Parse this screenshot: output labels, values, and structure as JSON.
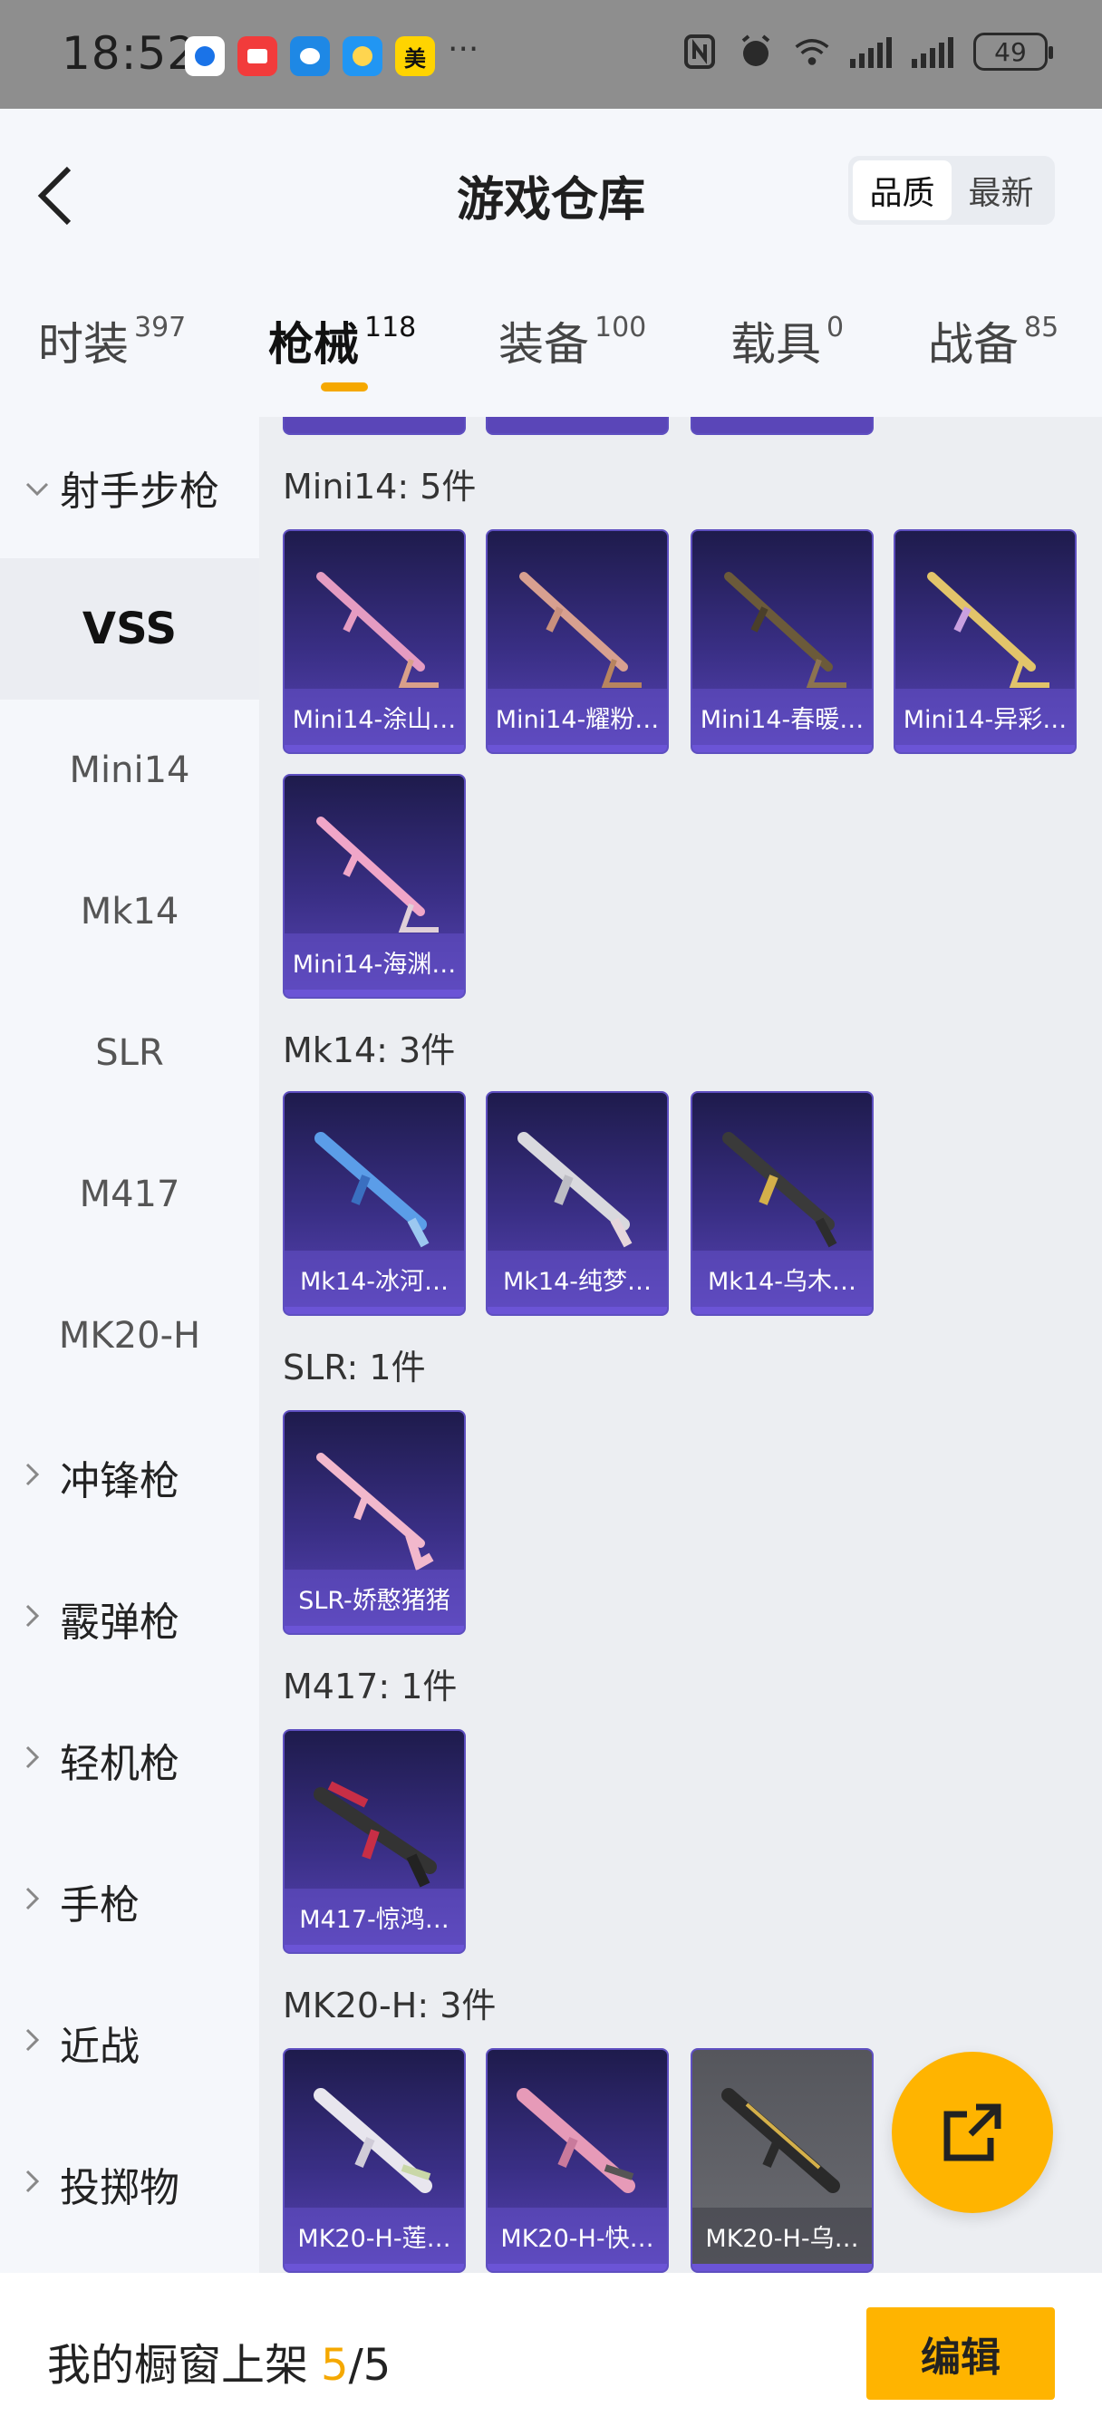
{
  "status_bar": {
    "time": "18:52",
    "notification_app_label": "美",
    "more": "···",
    "battery": "49"
  },
  "header": {
    "title": "游戏仓库",
    "sort_options": [
      {
        "label": "品质",
        "active": true
      },
      {
        "label": "最新",
        "active": false
      }
    ]
  },
  "tabs": [
    {
      "label": "时装",
      "count": "397",
      "active": false
    },
    {
      "label": "枪械",
      "count": "118",
      "active": true
    },
    {
      "label": "装备",
      "count": "100",
      "active": false
    },
    {
      "label": "载具",
      "count": "0",
      "active": false
    },
    {
      "label": "战备",
      "count": "85",
      "active": false
    }
  ],
  "sidebar": {
    "items": [
      {
        "label": "射手步枪",
        "type": "group",
        "expanded": true
      },
      {
        "label": "VSS",
        "type": "sub",
        "selected": true
      },
      {
        "label": "Mini14",
        "type": "sub"
      },
      {
        "label": "Mk14",
        "type": "sub"
      },
      {
        "label": "SLR",
        "type": "sub"
      },
      {
        "label": "M417",
        "type": "sub"
      },
      {
        "label": "MK20-H",
        "type": "sub"
      },
      {
        "label": "冲锋枪",
        "type": "group"
      },
      {
        "label": "霰弹枪",
        "type": "group"
      },
      {
        "label": "轻机枪",
        "type": "group"
      },
      {
        "label": "手枪",
        "type": "group"
      },
      {
        "label": "近战",
        "type": "group"
      },
      {
        "label": "投掷物",
        "type": "group"
      }
    ]
  },
  "sections": [
    {
      "title": "Mini14: 5件",
      "items": [
        "Mini14-涂山…",
        "Mini14-耀粉…",
        "Mini14-春暖…",
        "Mini14-异彩…",
        "Mini14-海渊…"
      ]
    },
    {
      "title": "Mk14: 3件",
      "items": [
        "Mk14-冰河…",
        "Mk14-纯梦…",
        "Mk14-乌木…"
      ]
    },
    {
      "title": "SLR: 1件",
      "items": [
        "SLR-娇憨猪猪"
      ]
    },
    {
      "title": "M417: 1件",
      "items": [
        "M417-惊鸿…"
      ]
    },
    {
      "title": "MK20-H: 3件",
      "items": [
        "MK20-H-莲…",
        "MK20-H-快…",
        "MK20-H-乌…"
      ]
    }
  ],
  "bottom_bar": {
    "label": "我的橱窗上架",
    "count": "5",
    "slash": "/",
    "total": "5",
    "edit_button": "编辑"
  },
  "colors": {
    "accent": "#ffb400",
    "card_purple": "#3a2f86",
    "card_border": "#5e4fc0"
  }
}
